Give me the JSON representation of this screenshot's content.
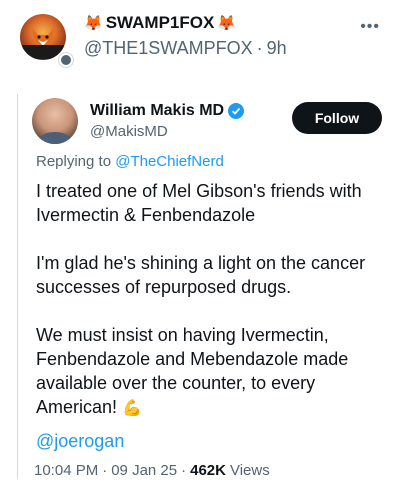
{
  "outer_post": {
    "display_name": "SWAMP1FOX",
    "name_prefix_emoji": "🦊",
    "name_suffix_emoji": "🦊",
    "handle": "@THE1SWAMPFOX",
    "separator": "·",
    "time_ago": "9h",
    "more_icon": "more-horizontal-icon"
  },
  "quoted_post": {
    "author_name": "William Makis MD",
    "author_handle": "@MakisMD",
    "verified": true,
    "follow_label": "Follow",
    "reply_prefix": "Replying to",
    "reply_to": "@TheChiefNerd",
    "paragraphs": [
      "I treated one of Mel Gibson's friends with Ivermectin & Fenbendazole",
      "I'm glad he's shining a light on the cancer successes of repurposed drugs.",
      "We must insist on having Ivermectin, Fenbendazole and Mebendazole made available over the counter, to every American!"
    ],
    "flex_emoji": "💪",
    "link": "@joerogan",
    "time": "10:04 PM",
    "date": "09 Jan 25",
    "dot": "·",
    "views_count": "462K",
    "views_label": "Views"
  },
  "colors": {
    "accent_blue": "#1d9bf0",
    "text": "#0f1419",
    "muted": "#536471",
    "button_bg": "#0f1419"
  }
}
